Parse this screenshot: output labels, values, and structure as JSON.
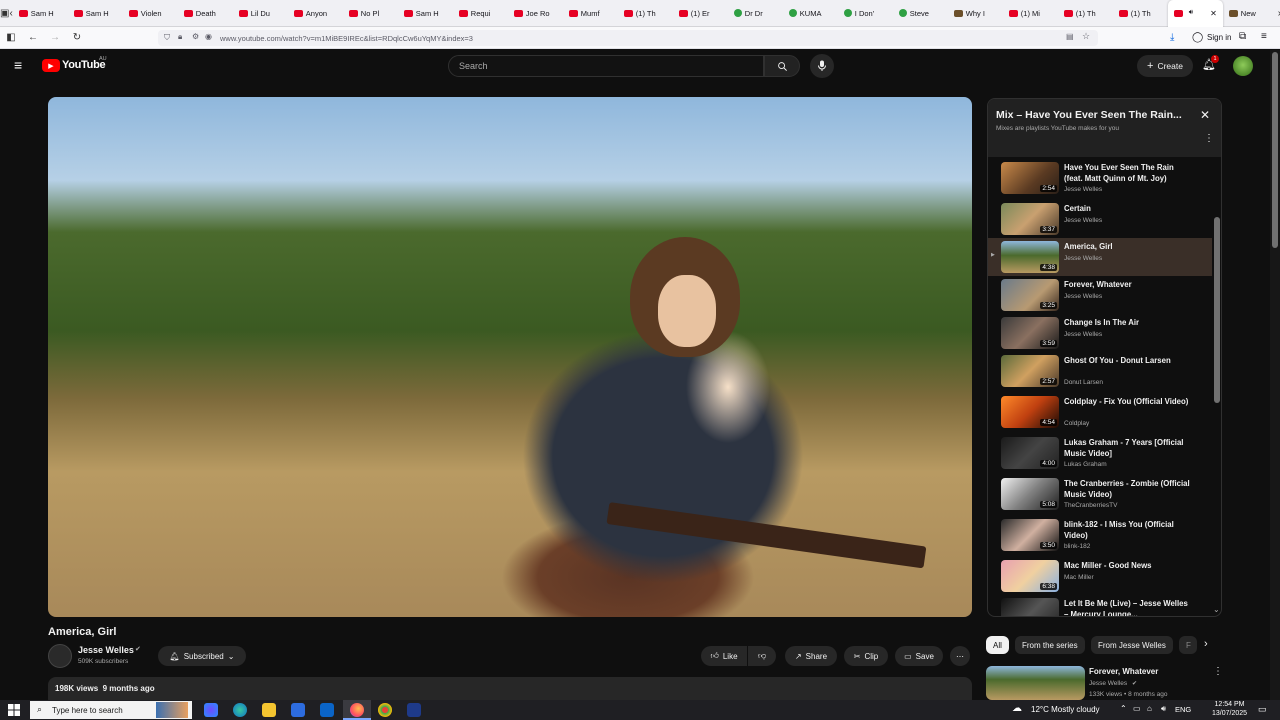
{
  "browser": {
    "tabs": [
      {
        "label": "Sam H",
        "icon": "youtube-icon"
      },
      {
        "label": "Sam H",
        "icon": "youtube-icon"
      },
      {
        "label": "Violen",
        "icon": "youtube-icon"
      },
      {
        "label": "Death",
        "icon": "youtube-icon"
      },
      {
        "label": "Lil Du",
        "icon": "youtube-icon"
      },
      {
        "label": "Anyon",
        "icon": "youtube-icon"
      },
      {
        "label": "No Pl",
        "icon": "youtube-icon"
      },
      {
        "label": "Sam H",
        "icon": "youtube-icon"
      },
      {
        "label": "Requi",
        "icon": "youtube-icon"
      },
      {
        "label": "Joe Ro",
        "icon": "youtube-icon"
      },
      {
        "label": "Mumf",
        "icon": "youtube-icon"
      },
      {
        "label": "(1) Th",
        "icon": "youtube-icon"
      },
      {
        "label": "(1) Er",
        "icon": "youtube-icon"
      },
      {
        "label": "Dr Dr",
        "icon": "play-icon"
      },
      {
        "label": "KUMA",
        "icon": "play-icon"
      },
      {
        "label": "I Don'",
        "icon": "play-icon"
      },
      {
        "label": "Steve",
        "icon": "play-icon"
      },
      {
        "label": "Why I",
        "icon": "site-icon"
      },
      {
        "label": "(1) Mi",
        "icon": "youtube-icon"
      },
      {
        "label": "(1) Th",
        "icon": "youtube-icon"
      },
      {
        "label": "(1) Th",
        "icon": "youtube-icon"
      },
      {
        "label": "",
        "icon": "youtube-icon"
      },
      {
        "label": "New",
        "icon": "site-icon"
      }
    ],
    "url": "www.youtube.com/watch?v=m1MiBE9IREc&list=RDqlcCw6uYqMY&index=3",
    "sign_in": "Sign in"
  },
  "youtube": {
    "logo_text": "YouTube",
    "region": "AU",
    "search_placeholder": "Search",
    "create_label": "Create",
    "notification_count": "1"
  },
  "video": {
    "title": "America, Girl",
    "channel": "Jesse Welles",
    "subscribers": "509K subscribers",
    "subscribed_label": "Subscribed",
    "like_label": "Like",
    "share_label": "Share",
    "clip_label": "Clip",
    "save_label": "Save",
    "views": "198K views",
    "age": "9 months ago"
  },
  "playlist": {
    "title": "Mix – Have You Ever Seen The Rain...",
    "subtitle": "Mixes are playlists YouTube makes for you",
    "items": [
      {
        "title": "Have You Ever Seen The Rain (feat. Matt Quinn of Mt. Joy)",
        "channel": "Jesse Welles",
        "duration": "2:54",
        "active": false
      },
      {
        "title": "Certain",
        "channel": "Jesse Welles",
        "duration": "3:37",
        "active": false
      },
      {
        "title": "America, Girl",
        "channel": "Jesse Welles",
        "duration": "4:38",
        "active": true
      },
      {
        "title": "Forever, Whatever",
        "channel": "Jesse Welles",
        "duration": "3:25",
        "active": false
      },
      {
        "title": "Change Is In The Air",
        "channel": "Jesse Welles",
        "duration": "3:59",
        "active": false
      },
      {
        "title": "Ghost Of You - Donut Larsen",
        "channel": "Donut Larsen",
        "duration": "2:57",
        "active": false
      },
      {
        "title": "Coldplay - Fix You (Official Video)",
        "channel": "Coldplay",
        "duration": "4:54",
        "active": false
      },
      {
        "title": "Lukas Graham - 7 Years [Official Music Video]",
        "channel": "Lukas Graham",
        "duration": "4:00",
        "active": false
      },
      {
        "title": "The Cranberries - Zombie (Official Music Video)",
        "channel": "TheCranberriesTV",
        "duration": "5:08",
        "active": false
      },
      {
        "title": "blink-182 - I Miss You (Official Video)",
        "channel": "blink-182",
        "duration": "3:50",
        "active": false
      },
      {
        "title": "Mac Miller - Good News",
        "channel": "Mac Miller",
        "duration": "6:38",
        "active": false
      },
      {
        "title": "Let It Be Me (Live) – Jesse Welles – Mercury Lounge...",
        "channel": "",
        "duration": "",
        "active": false
      }
    ]
  },
  "chips": [
    "All",
    "From the series",
    "From Jesse Welles",
    "F"
  ],
  "up_next": {
    "title": "Forever, Whatever",
    "channel": "Jesse Welles",
    "meta": "133K views • 8 months ago"
  },
  "taskbar": {
    "search_placeholder": "Type here to search",
    "weather": "12°C  Mostly cloudy",
    "lang": "ENG",
    "time": "12:54 PM",
    "date": "13/07/2025"
  }
}
